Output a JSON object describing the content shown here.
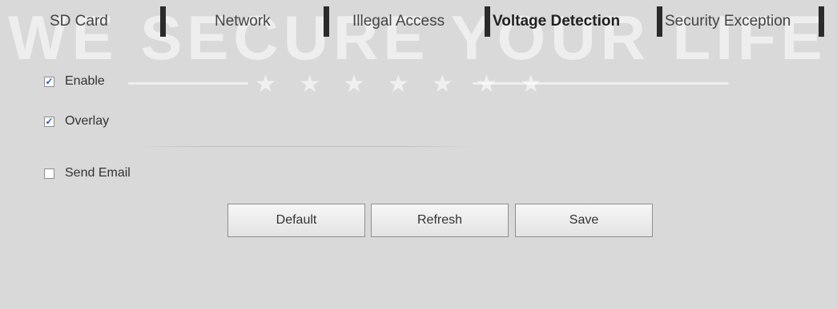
{
  "watermark": {
    "text": "WE SECURE YOUR LIFE",
    "stars": "★ ★ ★ ★ ★ ★ ★"
  },
  "tabs": [
    {
      "label": "SD Card",
      "active": false
    },
    {
      "label": "Network",
      "active": false
    },
    {
      "label": "Illegal Access",
      "active": false
    },
    {
      "label": "Voltage Detection",
      "active": true
    },
    {
      "label": "Security Exception",
      "active": false
    }
  ],
  "options": {
    "enable": {
      "label": "Enable",
      "checked": true
    },
    "overlay": {
      "label": "Overlay",
      "checked": true
    },
    "send_email": {
      "label": "Send Email",
      "checked": false
    }
  },
  "buttons": {
    "default": "Default",
    "refresh": "Refresh",
    "save": "Save"
  },
  "colors": {
    "background": "#d9d9d9",
    "tab_separator": "#2b2b2b",
    "checkmark": "#2a55b8"
  }
}
